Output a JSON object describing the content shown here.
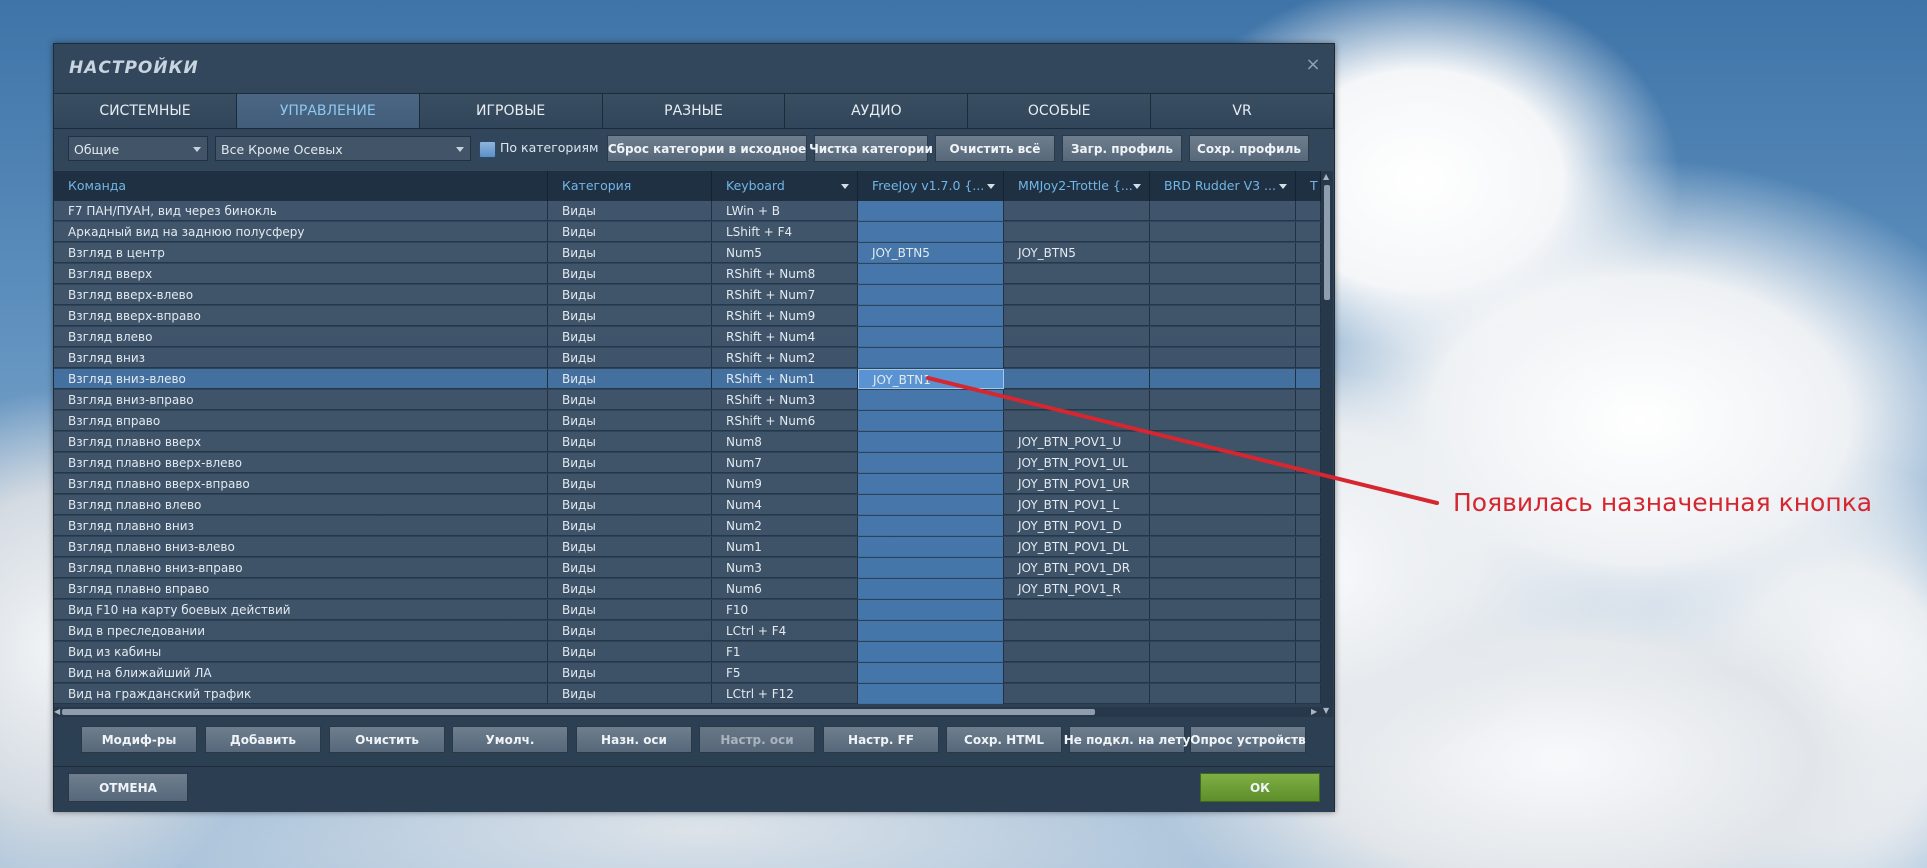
{
  "dialog": {
    "title": "НАСТРОЙКИ",
    "close_icon": "×"
  },
  "tabs": [
    {
      "label": "СИСТЕМНЫЕ",
      "active": false
    },
    {
      "label": "УПРАВЛЕНИЕ",
      "active": true
    },
    {
      "label": "ИГРОВЫЕ",
      "active": false
    },
    {
      "label": "РАЗНЫЕ",
      "active": false
    },
    {
      "label": "АУДИО",
      "active": false
    },
    {
      "label": "ОСОБЫЕ",
      "active": false
    },
    {
      "label": "VR",
      "active": false
    }
  ],
  "filters": {
    "aircraft_select": "Общие",
    "category_select": "Все Кроме Осевых",
    "by_category_label": "По категориям",
    "by_category_checked": false,
    "buttons": [
      "Сброс категории в исходное",
      "Чистка категории",
      "Очистить всё",
      "Загр. профиль",
      "Сохр. профиль"
    ]
  },
  "table": {
    "headers": [
      "Команда",
      "Категория",
      "Keyboard",
      "FreeJoy v1.7.0 {...",
      "MMJoy2-Trottle {...",
      "BRD Rudder V3 ...",
      "T"
    ],
    "rows": [
      [
        "F7 ПАН/ПУАН, вид через бинокль",
        "Виды",
        "LWin + B",
        "",
        "",
        ""
      ],
      [
        "Аркадный вид на заднюю полусферу",
        "Виды",
        "LShift + F4",
        "",
        "",
        ""
      ],
      [
        "Взгляд в центр",
        "Виды",
        "Num5",
        "JOY_BTN5",
        "JOY_BTN5",
        ""
      ],
      [
        "Взгляд вверх",
        "Виды",
        "RShift + Num8",
        "",
        "",
        ""
      ],
      [
        "Взгляд вверх-влево",
        "Виды",
        "RShift + Num7",
        "",
        "",
        ""
      ],
      [
        "Взгляд вверх-вправо",
        "Виды",
        "RShift + Num9",
        "",
        "",
        ""
      ],
      [
        "Взгляд влево",
        "Виды",
        "RShift + Num4",
        "",
        "",
        ""
      ],
      [
        "Взгляд вниз",
        "Виды",
        "RShift + Num2",
        "",
        "",
        ""
      ],
      [
        "Взгляд вниз-влево",
        "Виды",
        "RShift + Num1",
        "JOY_BTN1",
        "",
        ""
      ],
      [
        "Взгляд вниз-вправо",
        "Виды",
        "RShift + Num3",
        "",
        "",
        ""
      ],
      [
        "Взгляд вправо",
        "Виды",
        "RShift + Num6",
        "",
        "",
        ""
      ],
      [
        "Взгляд плавно вверх",
        "Виды",
        "Num8",
        "",
        "JOY_BTN_POV1_U",
        ""
      ],
      [
        "Взгляд плавно вверх-влево",
        "Виды",
        "Num7",
        "",
        "JOY_BTN_POV1_UL",
        ""
      ],
      [
        "Взгляд плавно вверх-вправо",
        "Виды",
        "Num9",
        "",
        "JOY_BTN_POV1_UR",
        ""
      ],
      [
        "Взгляд плавно влево",
        "Виды",
        "Num4",
        "",
        "JOY_BTN_POV1_L",
        ""
      ],
      [
        "Взгляд плавно вниз",
        "Виды",
        "Num2",
        "",
        "JOY_BTN_POV1_D",
        ""
      ],
      [
        "Взгляд плавно вниз-влево",
        "Виды",
        "Num1",
        "",
        "JOY_BTN_POV1_DL",
        ""
      ],
      [
        "Взгляд плавно вниз-вправо",
        "Виды",
        "Num3",
        "",
        "JOY_BTN_POV1_DR",
        ""
      ],
      [
        "Взгляд плавно вправо",
        "Виды",
        "Num6",
        "",
        "JOY_BTN_POV1_R",
        ""
      ],
      [
        "Вид F10 на карту боевых действий",
        "Виды",
        "F10",
        "",
        "",
        ""
      ],
      [
        "Вид в преследовании",
        "Виды",
        "LCtrl + F4",
        "",
        "",
        ""
      ],
      [
        "Вид из кабины",
        "Виды",
        "F1",
        "",
        "",
        ""
      ],
      [
        "Вид на ближайший ЛА",
        "Виды",
        "F5",
        "",
        "",
        ""
      ],
      [
        "Вид на гражданский трафик",
        "Виды",
        "LCtrl + F12",
        "",
        "",
        ""
      ]
    ],
    "selected_row": 8
  },
  "bottom_buttons": [
    {
      "label": "Модиф-ры",
      "disabled": false
    },
    {
      "label": "Добавить",
      "disabled": false
    },
    {
      "label": "Очистить",
      "disabled": false
    },
    {
      "label": "Умолч.",
      "disabled": false
    },
    {
      "label": "Назн. оси",
      "disabled": false
    },
    {
      "label": "Настр. оси",
      "disabled": true
    },
    {
      "label": "Настр. FF",
      "disabled": false
    },
    {
      "label": "Сохр. HTML",
      "disabled": false
    },
    {
      "label": "Не подкл. на лету",
      "disabled": false
    },
    {
      "label": "Опрос устройств",
      "disabled": false
    }
  ],
  "footer": {
    "cancel_label": "ОТМЕНА",
    "ok_label": "ОК"
  },
  "annotation": {
    "text": "Появилась назначенная кнопка",
    "color": "#d62630"
  }
}
